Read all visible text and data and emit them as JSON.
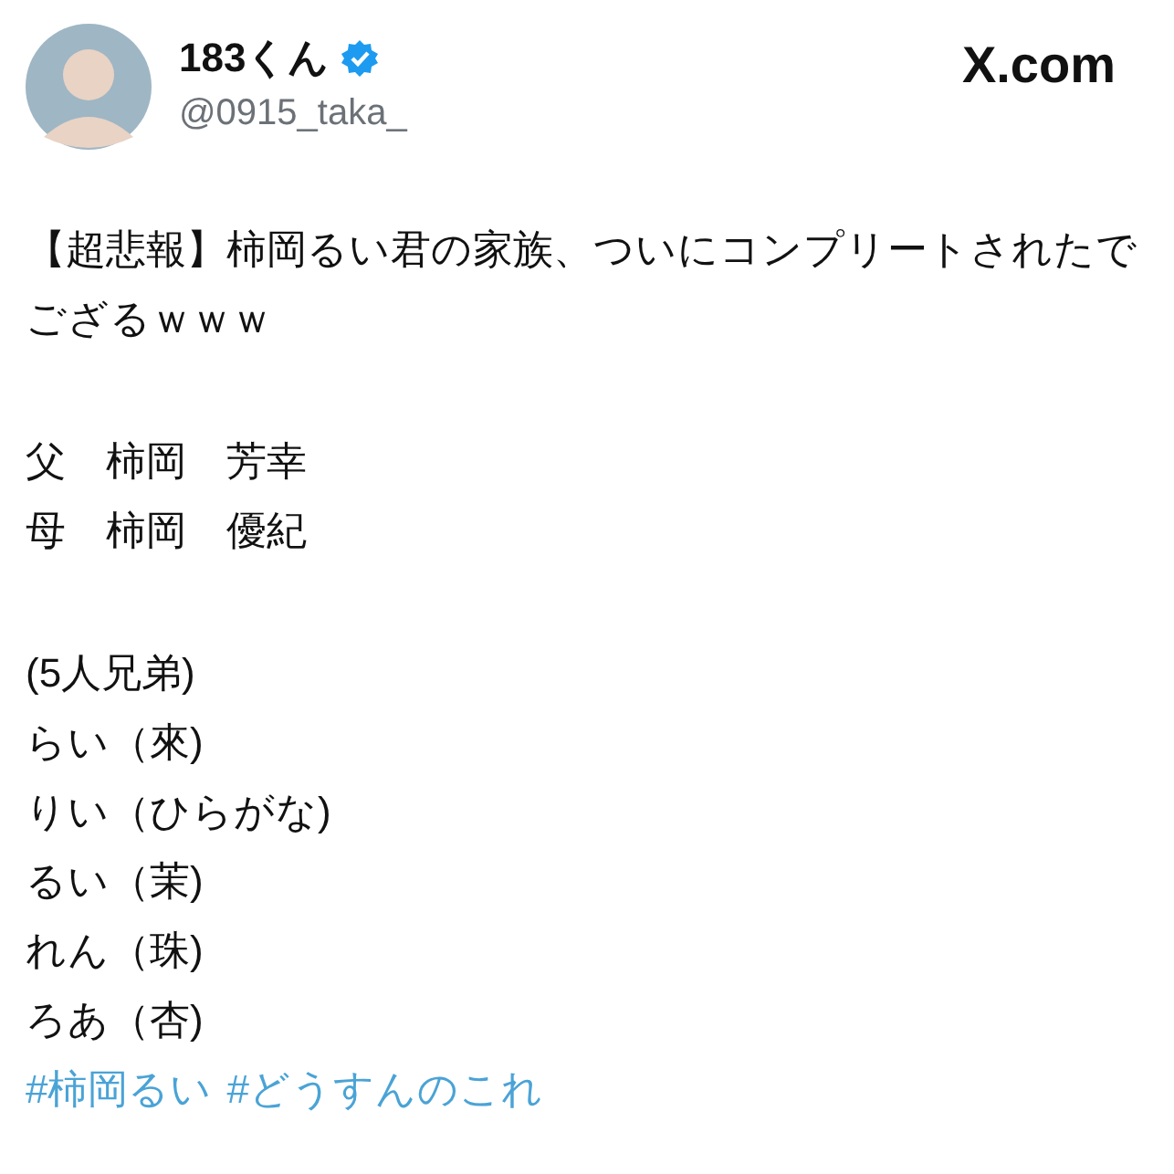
{
  "post": {
    "author": {
      "name": "183くん",
      "verified": true,
      "handle": "@0915_taka_"
    },
    "site": "X.com",
    "paragraphs": [
      {
        "lines": [
          "【超悲報】柿岡るい君の家族、ついにコンプリートされたでござるｗｗｗ"
        ]
      },
      {
        "lines": [
          "父　柿岡　芳幸",
          "母　柿岡　優紀"
        ]
      },
      {
        "lines": [
          "(5人兄弟)",
          "らい（來)",
          "りい（ひらがな)",
          "るい（茉)",
          "れん（珠)",
          "ろあ（杏)"
        ]
      }
    ],
    "hashtags": [
      "#柿岡るい",
      "#どうすんのこれ"
    ]
  }
}
